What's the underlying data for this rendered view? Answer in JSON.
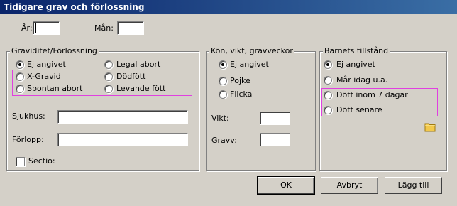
{
  "window": {
    "title": "Tidigare grav och förlossning"
  },
  "top": {
    "year_label": "År:",
    "year_value": "",
    "month_label": "Mån:",
    "month_value": ""
  },
  "pregnancy_group": {
    "title": "Graviditet/Förlossning",
    "options": [
      {
        "label": "Ej angivet",
        "selected": true
      },
      {
        "label": "Legal abort",
        "selected": false
      },
      {
        "label": "X-Gravid",
        "selected": false
      },
      {
        "label": "Dödfött",
        "selected": false
      },
      {
        "label": "Spontan abort",
        "selected": false
      },
      {
        "label": "Levande fött",
        "selected": false
      }
    ],
    "hospital_label": "Sjukhus:",
    "hospital_value": "",
    "course_label": "Förlopp:",
    "course_value": "",
    "sectio_label": "Sectio:",
    "sectio_checked": false
  },
  "sex_group": {
    "title": "Kön, vikt, gravveckor",
    "options": [
      {
        "label": "Ej angivet",
        "selected": true
      },
      {
        "label": "Pojke",
        "selected": false
      },
      {
        "label": "Flicka",
        "selected": false
      }
    ],
    "weight_label": "Vikt:",
    "weight_value": "",
    "gw_label": "Gravv:",
    "gw_value": ""
  },
  "child_group": {
    "title": "Barnets tillstånd",
    "options": [
      {
        "label": "Ej angivet",
        "selected": true
      },
      {
        "label": "Mår idag u.a.",
        "selected": false
      },
      {
        "label": "Dött inom 7 dagar",
        "selected": false
      },
      {
        "label": "Dött senare",
        "selected": false
      }
    ]
  },
  "buttons": {
    "ok": "OK",
    "cancel": "Avbryt",
    "add": "Lägg till"
  },
  "colors": {
    "highlight": "#e040e0",
    "titlebar": "#0a246a",
    "face": "#d4d0c8"
  }
}
